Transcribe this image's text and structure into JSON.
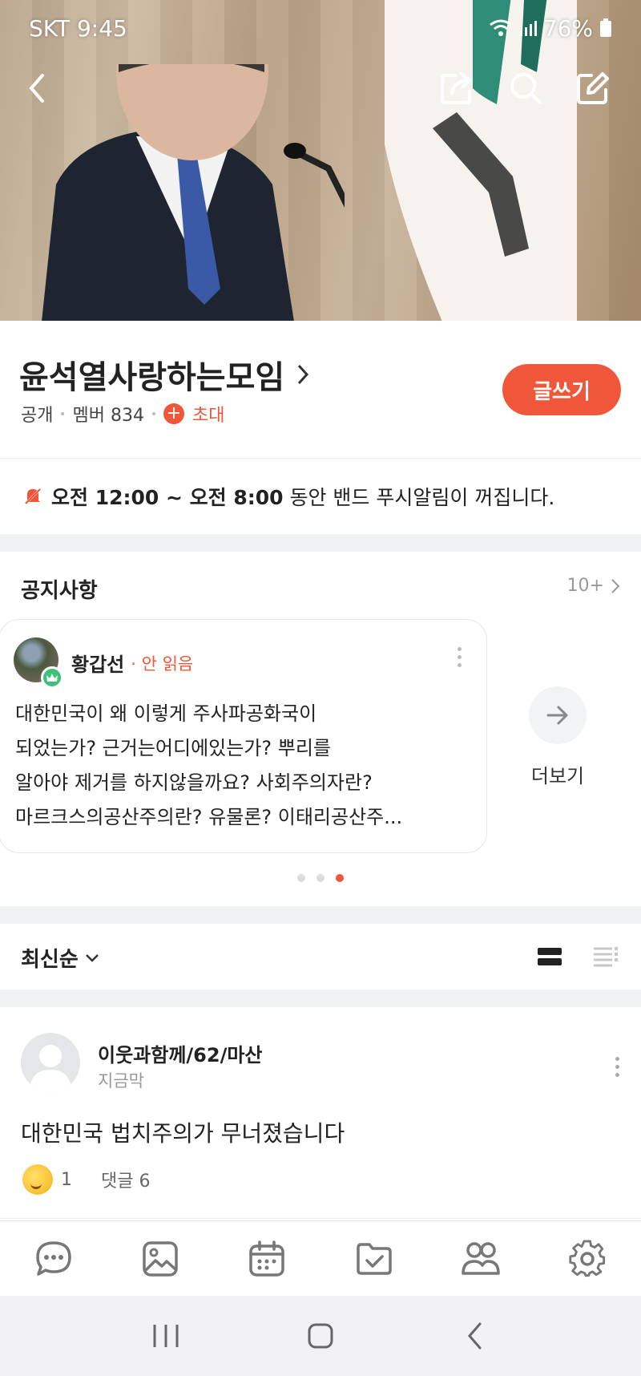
{
  "status_bar": {
    "carrier_time": "SKT 9:45",
    "battery": "76%"
  },
  "band": {
    "name": "윤석열사랑하는모임",
    "privacy": "공개",
    "members": "멤버 834",
    "invite": "초대",
    "write_label": "글쓰기"
  },
  "notification": {
    "start": "오전 12:00 ~ 오전 8:00",
    "rest": "동안 밴드 푸시알림이 꺼집니다."
  },
  "notice": {
    "title": "공지사항",
    "count": "10+",
    "card": {
      "author": "황갑선",
      "status": "· 안 읽음",
      "lines": [
        "대한민국이 왜 이렇게 주사파공화국이",
        "되었는가? 근거는어디에있는가? 뿌리를",
        "알아야 제거를 하지않을까요? 사회주의자란?",
        "마르크스의공산주의란? 유물론? 이태리공산주..."
      ]
    },
    "more_label": "더보기",
    "pager_count": 3,
    "pager_active": 3
  },
  "sort": {
    "label": "최신순"
  },
  "post": {
    "author": "이웃과함께/62/마산",
    "time": "지금막",
    "text": "대한민국 법치주의가 무너졌습니다",
    "reactions": "1",
    "comments": "댓글 6"
  },
  "colors": {
    "accent": "#f0573a",
    "badge": "#3ec07a"
  },
  "icons": {
    "top_nav": [
      "back-icon",
      "share-icon",
      "search-icon",
      "edit-icon"
    ],
    "tabs": [
      "chat-icon",
      "photo-icon",
      "calendar-icon",
      "folder-icon",
      "members-icon",
      "settings-icon"
    ],
    "system": [
      "recent-apps-icon",
      "home-icon",
      "back-icon"
    ]
  }
}
